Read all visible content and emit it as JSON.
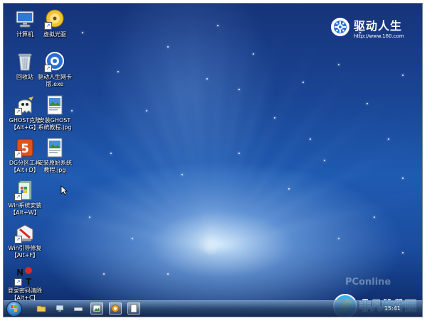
{
  "desktop": {
    "icons": [
      {
        "label": "计算机",
        "icon": "computer-icon"
      },
      {
        "label": "虚拟光驱",
        "icon": "virtual-drive-icon"
      },
      {
        "label": "回收站",
        "icon": "recycle-bin-icon"
      },
      {
        "label": "驱动人生网卡\n版.exe",
        "icon": "driver-exe-icon"
      },
      {
        "label": "GHOST克隆\n【Alt+G】",
        "icon": "ghost-icon"
      },
      {
        "label": "安装GHOST\n系统教程.jpg",
        "icon": "image-file-icon"
      },
      {
        "label": "DG分区工具\n【Alt+D】",
        "icon": "disk-genius-icon"
      },
      {
        "label": "安装原始系统\n教程.jpg",
        "icon": "image-file-icon"
      },
      {
        "label": "Win系统安装\n【Alt+W】",
        "icon": "windows-installer-icon"
      },
      {
        "label": "Win引导修复\n【Alt+F】",
        "icon": "boot-repair-icon"
      },
      {
        "label": "登录密码清除\n【Alt+C】",
        "icon": "password-clear-icon"
      }
    ]
  },
  "brand": {
    "title": "驱动人生",
    "url": "http://www.160.com"
  },
  "taskbar": {
    "clock": "15:41",
    "buttons": [
      "explorer",
      "network",
      "keyboard",
      "image-viewer",
      "driver-app",
      "file"
    ]
  },
  "watermark": {
    "pconline": "PConline",
    "site": "非凡软件园"
  },
  "colors": {
    "desktop_bg": "#1f5bb2",
    "taskbar": "#28466e",
    "label_text": "#ffffff",
    "brand_accent": "#3fb0e8"
  }
}
